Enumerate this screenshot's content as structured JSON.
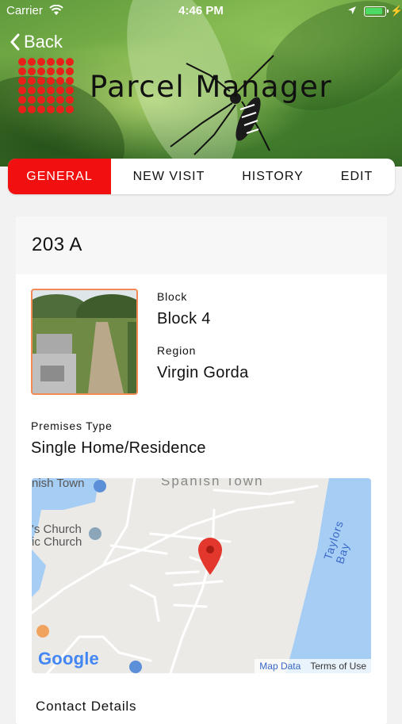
{
  "status_bar": {
    "carrier": "Carrier",
    "time": "4:46 PM"
  },
  "nav": {
    "back_label": "Back"
  },
  "app": {
    "title": "Parcel Manager",
    "accent_color": "#f20f0f"
  },
  "tabs": [
    {
      "label": "GENERAL",
      "active": true
    },
    {
      "label": "NEW VISIT",
      "active": false
    },
    {
      "label": "HISTORY",
      "active": false
    },
    {
      "label": "EDIT",
      "active": false
    }
  ],
  "parcel": {
    "id": "203 A",
    "block_label": "Block",
    "block_value": "Block 4",
    "region_label": "Region",
    "region_value": "Virgin Gorda",
    "premises_label": "Premises Type",
    "premises_value": "Single Home/Residence"
  },
  "map": {
    "place_spanish_town_top": "Spanish Town",
    "place_spanish_town_left": "nish Town",
    "place_church1": "'s Church",
    "place_church2": "ic Church",
    "place_taylors_bay": "Taylors Bay",
    "logo": "Google",
    "map_data": "Map Data",
    "terms": "Terms of Use"
  },
  "contact": {
    "heading": "Contact Details"
  }
}
